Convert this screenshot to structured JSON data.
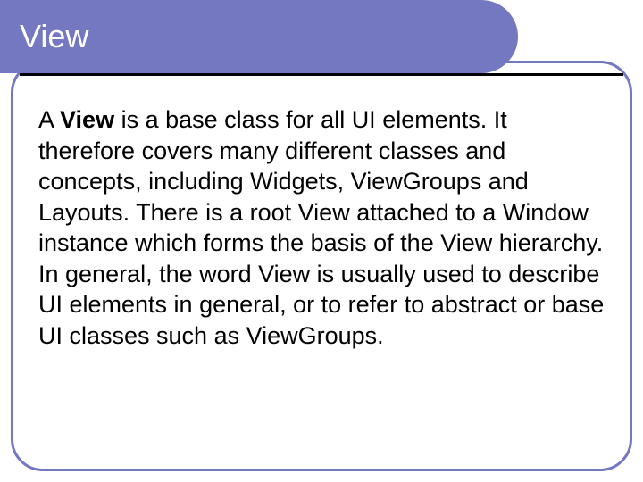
{
  "slide": {
    "title": "View",
    "body_prefix": "A ",
    "body_bold": "View",
    "body_rest": " is a base class for all UI elements. It therefore covers many different classes and concepts, including Widgets, ViewGroups and Layouts. There is a root View attached to a Window instance which forms the basis of the View hierarchy. In general, the word View is usually used to describe UI elements in general, or to refer to abstract or base UI classes such as ViewGroups."
  }
}
